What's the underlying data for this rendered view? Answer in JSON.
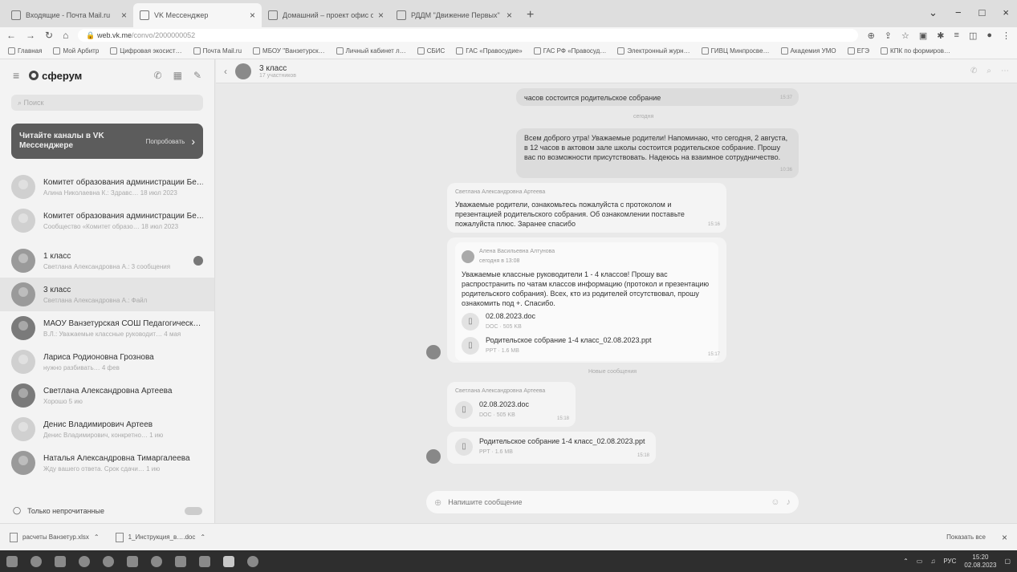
{
  "browser": {
    "tabs": [
      {
        "title": "Входящие - Почта Mail.ru",
        "active": false
      },
      {
        "title": "VK Мессенджер",
        "active": true
      },
      {
        "title": "Домашний – проект офис он…",
        "active": false
      },
      {
        "title": "РДДМ \"Движение Первых\"",
        "active": false
      }
    ],
    "url_host": "web.vk.me",
    "url_path": "/convo/2000000052",
    "bookmarks": [
      "Главная",
      "Мой Арбитр",
      "Цифровая экосист…",
      "Почта Mail.ru",
      "МБОУ \"Ванзетурск…",
      "Личный кабинет л…",
      "СБИС",
      "ГАС «Правосудие»",
      "ГАС РФ «Правосуд…",
      "Электронный журн…",
      "ГИВЦ Минпросве…",
      "Академия УМО",
      "ЕГЭ",
      "КПК по формиров…"
    ]
  },
  "sidebar": {
    "logo": "сферум",
    "search_placeholder": "Поиск",
    "promo_text": "Читайте каналы в VK Мессенджере",
    "promo_button": "Попробовать",
    "chats": [
      {
        "name": "Комитет образования администрации Бе…",
        "preview": "Алина Николаевна К.: Здравс… 18 июл 2023",
        "selected": false
      },
      {
        "name": "Комитет образования администрации Бе…",
        "preview": "Сообщество «Комитет образо… 18 июл 2023",
        "selected": false
      },
      {
        "name": "1 класс",
        "preview": "Светлана Александровна А.: 3 сообщения",
        "selected": false
      },
      {
        "name": "3 класс",
        "preview": "Светлана Александровна А.: Файл",
        "selected": true
      },
      {
        "name": "МАОУ Ванзетурская СОШ Педагогическ…",
        "preview": "В.Л.: Уважаемые классные руководит… 4 мая",
        "selected": false
      },
      {
        "name": "Лариса Родионовна Грознова",
        "preview": "нужно разбивать… 4 фев",
        "selected": false
      },
      {
        "name": "Светлана Александровна Артеева",
        "preview": "Хорошо 5 ию",
        "selected": false
      },
      {
        "name": "Денис Владимирович Артеев",
        "preview": "Денис Владимирович, конкретно… 1 ию",
        "selected": false
      },
      {
        "name": "Наталья Александровна Тимаргалеева",
        "preview": "Жду вашего ответа. Срок сдачи… 1 ию",
        "selected": false
      }
    ],
    "footer_label": "Только непрочитанные"
  },
  "conversation": {
    "title": "3 класс",
    "subtitle": "17 участников",
    "msg1_text": "часов состоится родительское собрание",
    "msg1_time": "15:37",
    "divider_today": "сегодня",
    "msg2_text": "Всем доброго утра! Уважаемые родители! Напоминаю, что сегодня, 2 августа, в 12 часов в актовом зале школы состоится родительское собрание. Прошу вас по возможности присутствовать. Надеюсь на взаимное сотрудничество.",
    "msg2_time": "10:36",
    "msg3_sender": "Светлана Александровна Артеева",
    "msg3_text": "Уважаемые родители, ознакомьтесь пожалуйста с протоколом и презентацией родительского собрания. Об ознакомлении поставьте пожалуйста плюс. Заранее спасибо",
    "msg3_time": "15:16",
    "fwd_sender": "Алена Васильевна Алтунова",
    "fwd_date": "сегодня в 13:08",
    "fwd_text": "Уважаемые классные руководители 1 - 4 классов! Прошу вас распространить по чатам классов информацию (протокол и презентацию родительского собрания). Всех, кто из родителей отсутствовал, прошу ознакомить под +. Спасибо.",
    "fwd_file1_name": "02.08.2023.doc",
    "fwd_file1_meta": "DOC · 505 KB",
    "fwd_file2_name": "Родительское собрание 1-4 класс_02.08.2023.ppt",
    "fwd_file2_meta": "PPT · 1.6 MB",
    "msg4_time": "15:17",
    "divider_new": "Новые сообщения",
    "msg5_sender": "Светлана Александровна Артеева",
    "msg5_file_name": "02.08.2023.doc",
    "msg5_file_meta": "DOC · 505 KB",
    "msg5_time": "15:18",
    "msg6_file_name": "Родительское собрание 1-4 класс_02.08.2023.ppt",
    "msg6_file_meta": "PPT · 1.6 MB",
    "msg6_time": "15:18",
    "composer_placeholder": "Напишите сообщение"
  },
  "downloads": {
    "items": [
      "расчеты Ванзетур.xlsx",
      "1_Инструкция_в….doc"
    ],
    "show_all": "Показать все"
  },
  "taskbar": {
    "lang": "РУС",
    "time": "15:20",
    "date": "02.08.2023"
  }
}
